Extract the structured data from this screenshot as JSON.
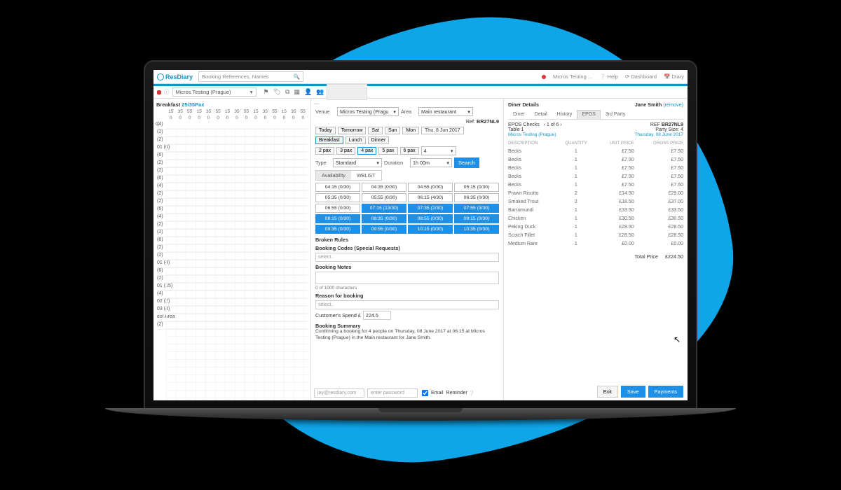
{
  "header": {
    "brand": "ResDiary",
    "search_ph": "Booking References, Names",
    "status": "Micros Testing ...",
    "help": "Help",
    "dashboard": "Dashboard",
    "diary": "Diary"
  },
  "sub": {
    "venue": "Micros Testing (Prague)"
  },
  "left": {
    "title": "Breakfast",
    "pax": "25/35Pax",
    "cols": [
      "15",
      "35",
      "55",
      "15",
      "35",
      "55",
      "15",
      "35",
      "55",
      "15",
      "35",
      "55",
      "15",
      "35",
      "55"
    ],
    "zeros": [
      "0",
      "0",
      "0",
      "0",
      "0",
      "0",
      "0",
      "0",
      "0",
      "0",
      "0",
      "0",
      "0",
      "0",
      "0"
    ],
    "rows": [
      "(4)",
      "(2)",
      "(2)",
      "01 (6)",
      "(6)",
      "(2)",
      "(2)",
      "(6)",
      "(4)",
      "(2)",
      "(2)",
      "(6)",
      "(4)",
      "(2)",
      "(2)",
      "(6)",
      "(2)",
      "(2)",
      "01 (4)",
      "(6)",
      "(2)",
      "01 (15)",
      "(4)",
      "02 (2)",
      "03 (4)",
      "est Area",
      "(2)"
    ]
  },
  "center": {
    "venue_lbl": "Venue",
    "venue": "Micros Testing (Pragu",
    "area_lbl": "Area",
    "area": "Main restaurant",
    "ref_lbl": "Ref:",
    "ref": "BR27NL9",
    "day_btns": [
      "Today",
      "Tomorrow",
      "Sat",
      "Sun",
      "Mon"
    ],
    "date": "Thu, 8 Jun 2017",
    "meal_btns": [
      "Breakfast",
      "Lunch",
      "Dinner"
    ],
    "meal_active": 0,
    "pax_btns": [
      "2 pax",
      "3 pax",
      "4 pax",
      "5 pax",
      "6 pax"
    ],
    "pax_active": 2,
    "pax_val": "4",
    "type_lbl": "Type",
    "type": "Standard",
    "dur_lbl": "Duration",
    "dur": "1h 00m",
    "search": "Search",
    "tabs": [
      "Availability",
      "WBLIST"
    ],
    "tab_active": 0,
    "slots": [
      {
        "t": "04:15 (0/30)"
      },
      {
        "t": "04:35 (0/30)"
      },
      {
        "t": "04:55 (0/30)"
      },
      {
        "t": "05:15 (0/30)"
      },
      {
        "t": "05:35 (0/30)"
      },
      {
        "t": "05:55 (0/30)"
      },
      {
        "t": "06:15 (4/30)"
      },
      {
        "t": "06:35 (0/30)"
      },
      {
        "t": "06:55 (0/30)"
      },
      {
        "t": "07:15 (13/30)",
        "hl": true
      },
      {
        "t": "07:35 (2/30)",
        "hl": true
      },
      {
        "t": "07:55 (3/30)",
        "hl": true
      },
      {
        "t": "08:15 (0/30)",
        "hl": true
      },
      {
        "t": "08:35 (0/30)",
        "hl": true
      },
      {
        "t": "08:55 (0/30)",
        "hl": true
      },
      {
        "t": "09:15 (0/30)",
        "hl": true
      },
      {
        "t": "09:35 (0/30)",
        "hl": true
      },
      {
        "t": "09:55 (0/30)",
        "hl": true
      },
      {
        "t": "10:15 (0/30)",
        "hl": true
      },
      {
        "t": "10:35 (0/30)",
        "hl": true
      }
    ],
    "broken": "Broken Rules",
    "codes": "Booking Codes (Special Requests)",
    "select_ph": "select..",
    "notes": "Booking Notes",
    "chars": "0 of 1000 characters",
    "reason": "Reason for booking",
    "spend_lbl": "Customer's Spend £",
    "spend": "224.5",
    "summary_t": "Booking Summary",
    "summary": "Confirming a booking for 4 people on Thursday, 08 June 2017 at 06:15 at Micros Testing (Prague) in the Main restaurant for Jane Smith.",
    "email_ph": "jay@resdiary.com",
    "pass_ph": "enter password",
    "cb_email": "Email",
    "cb_rem": "Reminder"
  },
  "diner": {
    "title": "Diner Details",
    "name": "Jane Smith",
    "remove": "(remove)",
    "tabs": [
      "Diner",
      "Detail",
      "History",
      "EPOS",
      "3rd Party"
    ],
    "tab_active": 3,
    "checks": "EPOS Checks",
    "pager": "1 of 6",
    "ref_lbl": "REF",
    "ref": "BR27NL9",
    "table": "Table 1",
    "party_lbl": "Party Size:",
    "party": "4",
    "loc": "Micros Testing (Prague)",
    "date": "Thursday, 08 June 2017",
    "cols": [
      "DESCRIPTION",
      "QUANTITY",
      "UNIT PRICE",
      "GROSS PRICE"
    ],
    "items": [
      {
        "d": "Becks",
        "q": "1",
        "u": "£7.50",
        "g": "£7.50"
      },
      {
        "d": "Becks",
        "q": "1",
        "u": "£7.50",
        "g": "£7.50"
      },
      {
        "d": "Becks",
        "q": "1",
        "u": "£7.50",
        "g": "£7.50"
      },
      {
        "d": "Becks",
        "q": "1",
        "u": "£7.50",
        "g": "£7.50"
      },
      {
        "d": "Becks",
        "q": "1",
        "u": "£7.50",
        "g": "£7.50"
      },
      {
        "d": "Prawn Risotto",
        "q": "2",
        "u": "£14.50",
        "g": "£29.00"
      },
      {
        "d": "Smoked Trout",
        "q": "2",
        "u": "£18.50",
        "g": "£37.00"
      },
      {
        "d": "Barramundi",
        "q": "1",
        "u": "£33.50",
        "g": "£33.50"
      },
      {
        "d": "Chicken",
        "q": "1",
        "u": "£30.50",
        "g": "£30.50"
      },
      {
        "d": "Peking Duck",
        "q": "1",
        "u": "£28.50",
        "g": "£28.50"
      },
      {
        "d": "Scotch Fillet",
        "q": "1",
        "u": "£28.50",
        "g": "£28.50"
      },
      {
        "d": "Medium Rare",
        "q": "1",
        "u": "£0.00",
        "g": "£0.00"
      }
    ],
    "total_lbl": "Total Price",
    "total": "£224.50",
    "exit": "Exit",
    "save": "Save",
    "pay": "Payments"
  }
}
